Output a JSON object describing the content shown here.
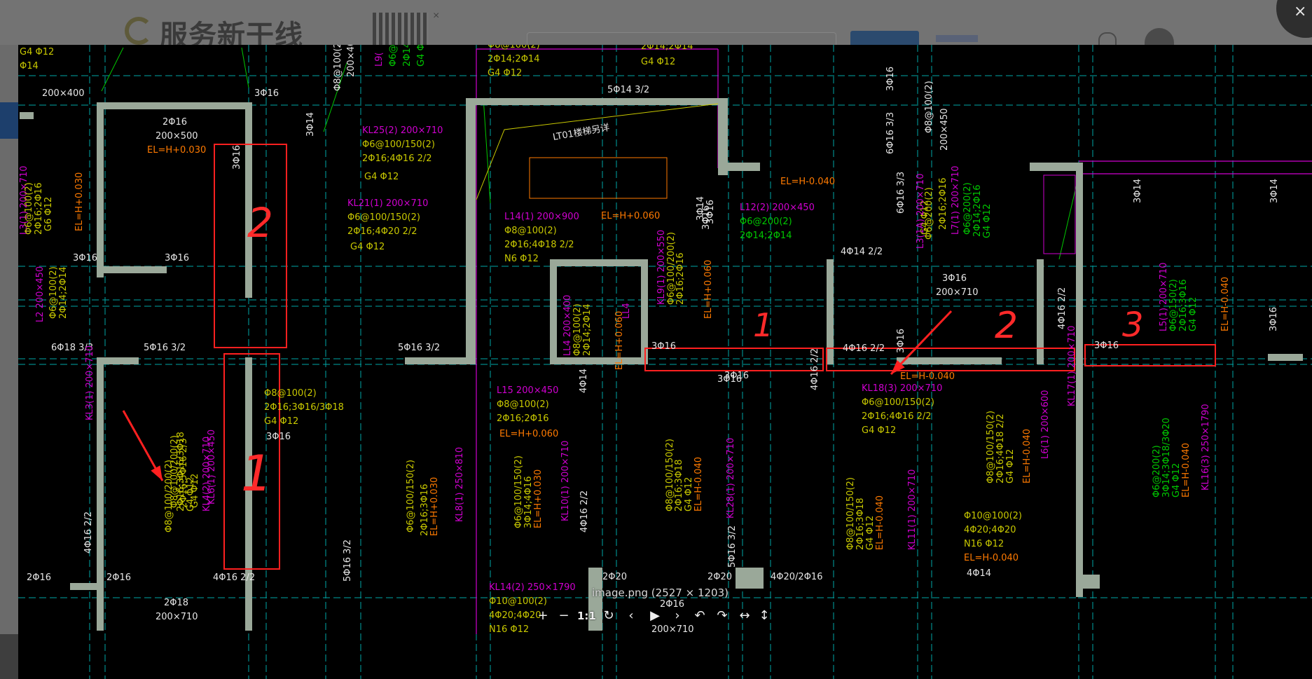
{
  "background_page": {
    "logo_text": "服务新干线"
  },
  "viewer": {
    "caption": "image.png (2527 × 1203)",
    "toolbar": {
      "zoom_in": "+",
      "zoom_out": "−",
      "actual_size": "1:1",
      "reset": "↻",
      "prev": "‹",
      "play": "▶",
      "next": "›",
      "rotate_left": "↶",
      "rotate_right": "↷",
      "flip_horizontal": "↔",
      "flip_vertical": "↕"
    },
    "close_label": "×"
  },
  "drawing": {
    "annotations": [
      {
        "id": "a2",
        "text": "2",
        "color": "#ff2a2a"
      },
      {
        "id": "a1",
        "text": "1",
        "color": "#ff2a2a"
      },
      {
        "id": "a1b",
        "text": "1",
        "color": "#ff2a2a"
      },
      {
        "id": "a2b",
        "text": "2",
        "color": "#ff2a2a"
      },
      {
        "id": "a3",
        "text": "3",
        "color": "#ff2a2a"
      }
    ],
    "colors": {
      "beam": "#c8c800",
      "green": "#00c800",
      "magenta": "#d000d0",
      "orange": "#ff7a00",
      "white": "#e6e6e6",
      "cyan": "#00a6a6",
      "wall": "#9aa899",
      "red": "#ff2020"
    },
    "labels": [
      {
        "t": "G4 Φ12",
        "c": "yellow"
      },
      {
        "t": "Φ14",
        "c": "yellow"
      },
      {
        "t": "200×400",
        "c": "white"
      },
      {
        "t": "3Φ16",
        "c": "white"
      },
      {
        "t": "Φ8@100(2)",
        "c": "white"
      },
      {
        "t": "200×400",
        "c": "white"
      },
      {
        "t": "L9(",
        "c": "magenta"
      },
      {
        "t": "Φ6@",
        "c": "green"
      },
      {
        "t": "2Φ14",
        "c": "green"
      },
      {
        "t": "G4 Φ",
        "c": "green"
      },
      {
        "t": "Φ8@100(2)",
        "c": "yellow"
      },
      {
        "t": "2Φ14;2Φ14",
        "c": "yellow"
      },
      {
        "t": "G4 Φ12",
        "c": "yellow"
      },
      {
        "t": "2Φ14;2Φ14",
        "c": "yellow"
      },
      {
        "t": "G4 Φ12",
        "c": "yellow"
      },
      {
        "t": "3Φ16",
        "c": "white"
      },
      {
        "t": "5Φ14 3/2",
        "c": "white"
      },
      {
        "t": "2Φ16",
        "c": "white"
      },
      {
        "t": "200×500",
        "c": "white"
      },
      {
        "t": "EL=H+0.030",
        "c": "orange"
      },
      {
        "t": "3Φ16",
        "c": "white"
      },
      {
        "t": "3Φ14",
        "c": "white"
      },
      {
        "t": "KL25(2) 200×710",
        "c": "magenta"
      },
      {
        "t": "Φ6@100/150(2)",
        "c": "yellow"
      },
      {
        "t": "2Φ16;4Φ16 2/2",
        "c": "yellow"
      },
      {
        "t": "G4 Φ12",
        "c": "yellow"
      },
      {
        "t": "LT01楼梯另详",
        "c": "white"
      },
      {
        "t": "Φ8@100(2)",
        "c": "white"
      },
      {
        "t": "200×450",
        "c": "white"
      },
      {
        "t": "6Φ16 3/3",
        "c": "white"
      },
      {
        "t": "EL=H-0.040",
        "c": "orange"
      },
      {
        "t": "L3(1) 200×710",
        "c": "magenta"
      },
      {
        "t": "Φ6@100(2)",
        "c": "yellow"
      },
      {
        "t": "2Φ16;2Φ16",
        "c": "yellow"
      },
      {
        "t": "G6 Φ12",
        "c": "yellow"
      },
      {
        "t": "EL=H+0.030",
        "c": "orange"
      },
      {
        "t": "KL21(1) 200×710",
        "c": "magenta"
      },
      {
        "t": "Φ6@100/150(2)",
        "c": "yellow"
      },
      {
        "t": "2Φ16;4Φ20 2/2",
        "c": "yellow"
      },
      {
        "t": "G4 Φ12",
        "c": "yellow"
      },
      {
        "t": "L14(1) 200×900",
        "c": "magenta"
      },
      {
        "t": "Φ8@100(2)",
        "c": "yellow"
      },
      {
        "t": "2Φ16;4Φ18 2/2",
        "c": "yellow"
      },
      {
        "t": "N6 Φ12",
        "c": "yellow"
      },
      {
        "t": "EL=H+0.060",
        "c": "orange"
      },
      {
        "t": "3Φ16",
        "c": "white"
      },
      {
        "t": "L12(2) 200×450",
        "c": "magenta"
      },
      {
        "t": "Φ6@200(2)",
        "c": "green"
      },
      {
        "t": "2Φ14;2Φ14",
        "c": "green"
      },
      {
        "t": "6Φ16 3/3",
        "c": "white"
      },
      {
        "t": "G4 Φ12",
        "c": "yellow"
      },
      {
        "t": "L3(1A) 200×710",
        "c": "magenta"
      },
      {
        "t": "Φ6@200(2)",
        "c": "yellow"
      },
      {
        "t": "2Φ16;2Φ16",
        "c": "yellow"
      },
      {
        "t": "L7(1) 200×710",
        "c": "magenta"
      },
      {
        "t": "Φ6@200(2)",
        "c": "green"
      },
      {
        "t": "2Φ14;2Φ16",
        "c": "green"
      },
      {
        "t": "G4 Φ12",
        "c": "green"
      },
      {
        "t": "3Φ14",
        "c": "white"
      },
      {
        "t": "3Φ14",
        "c": "white"
      },
      {
        "t": "3Φ14",
        "c": "white"
      },
      {
        "t": "3Φ16",
        "c": "white"
      },
      {
        "t": "3Φ16",
        "c": "white"
      },
      {
        "t": "4Φ14 2/2",
        "c": "white"
      },
      {
        "t": "3Φ16",
        "c": "white"
      },
      {
        "t": "200×710",
        "c": "white"
      },
      {
        "t": "L2 200×450",
        "c": "magenta"
      },
      {
        "t": "Φ6@100(2)",
        "c": "yellow"
      },
      {
        "t": "2Φ14;2Φ14",
        "c": "yellow"
      },
      {
        "t": "3Φ16",
        "c": "white"
      },
      {
        "t": "LL4 200×400",
        "c": "magenta"
      },
      {
        "t": "Φ8@100(2)",
        "c": "yellow"
      },
      {
        "t": "2Φ14;2Φ14",
        "c": "yellow"
      },
      {
        "t": "EL=H+0.060",
        "c": "orange"
      },
      {
        "t": "LL4",
        "c": "magenta"
      },
      {
        "t": "KL9(1) 200×550",
        "c": "magenta"
      },
      {
        "t": "Φ6@100/200(2)",
        "c": "yellow"
      },
      {
        "t": "2Φ16;2Φ16",
        "c": "yellow"
      },
      {
        "t": "EL=H+0.060",
        "c": "orange"
      },
      {
        "t": "4Φ16 2/2",
        "c": "white"
      },
      {
        "t": "L5(1) 200×710",
        "c": "magenta"
      },
      {
        "t": "Φ6@150(2)",
        "c": "green"
      },
      {
        "t": "2Φ16;3Φ16",
        "c": "green"
      },
      {
        "t": "G4 Φ12",
        "c": "green"
      },
      {
        "t": "EL=H-0.040",
        "c": "orange"
      },
      {
        "t": "3Φ16",
        "c": "white"
      },
      {
        "t": "6Φ18 3/3",
        "c": "white"
      },
      {
        "t": "5Φ16 3/2",
        "c": "white"
      },
      {
        "t": "5Φ16 3/2",
        "c": "white"
      },
      {
        "t": "3Φ16",
        "c": "white"
      },
      {
        "t": "4Φ16 2/2",
        "c": "white"
      },
      {
        "t": "3Φ16",
        "c": "white"
      },
      {
        "t": "EL=H-0.040",
        "c": "orange"
      },
      {
        "t": "KL18(3) 200×710",
        "c": "magenta"
      },
      {
        "t": "Φ6@100/150(2)",
        "c": "yellow"
      },
      {
        "t": "2Φ16;4Φ16 2/2",
        "c": "yellow"
      },
      {
        "t": "G4 Φ12",
        "c": "yellow"
      },
      {
        "t": "3Φ16",
        "c": "white"
      },
      {
        "t": "KL17(1) 200×710",
        "c": "magenta"
      },
      {
        "t": "Φ8@100(2)",
        "c": "yellow"
      },
      {
        "t": "2Φ16;3Φ16/3Φ18",
        "c": "yellow"
      },
      {
        "t": "G4 Φ12",
        "c": "yellow"
      },
      {
        "t": "3Φ16",
        "c": "white"
      },
      {
        "t": "L15 200×450",
        "c": "magenta"
      },
      {
        "t": "Φ8@100(2)",
        "c": "yellow"
      },
      {
        "t": "2Φ16;2Φ16",
        "c": "yellow"
      },
      {
        "t": "EL=H+0.060",
        "c": "orange"
      },
      {
        "t": "4Φ14",
        "c": "white"
      },
      {
        "t": "4Φ16 2/2",
        "c": "white"
      },
      {
        "t": "KL3(1) 200×710",
        "c": "magenta"
      },
      {
        "t": "Φ8@100/200(2)",
        "c": "yellow"
      },
      {
        "t": "2Φ16;3Φ16/3Φ18",
        "c": "yellow"
      },
      {
        "t": "G4 Φ12",
        "c": "yellow"
      },
      {
        "t": "KL4(2) 200×710",
        "c": "magenta"
      },
      {
        "t": "Φ8@100/200(2)",
        "c": "yellow"
      },
      {
        "t": "2Φ16;5Φ16 2/3",
        "c": "yellow"
      },
      {
        "t": "G4 Φ12",
        "c": "yellow"
      },
      {
        "t": "KL6(1) 200×450",
        "c": "magenta"
      },
      {
        "t": "Φ6@100/150(2)",
        "c": "yellow"
      },
      {
        "t": "2Φ16;3Φ16",
        "c": "yellow"
      },
      {
        "t": "EL=H+0.030",
        "c": "orange"
      },
      {
        "t": "KL8(1) 250×810",
        "c": "magenta"
      },
      {
        "t": "Φ6@100/150(2)",
        "c": "yellow"
      },
      {
        "t": "3Φ14;4Φ16",
        "c": "yellow"
      },
      {
        "t": "EL=H+0.030",
        "c": "orange"
      },
      {
        "t": "KL10(1) 200×710",
        "c": "magenta"
      },
      {
        "t": "Φ8@100/150(2)",
        "c": "yellow"
      },
      {
        "t": "2Φ16;3Φ18",
        "c": "yellow"
      },
      {
        "t": "G4 Φ12",
        "c": "yellow"
      },
      {
        "t": "EL=H-0.040",
        "c": "orange"
      },
      {
        "t": "KL28(1) 200×710",
        "c": "magenta"
      },
      {
        "t": "Φ8@100/150(2)",
        "c": "yellow"
      },
      {
        "t": "2Φ16;3Φ18",
        "c": "yellow"
      },
      {
        "t": "G4 Φ12",
        "c": "yellow"
      },
      {
        "t": "EL=H-0.040",
        "c": "orange"
      },
      {
        "t": "KL11(1) 200×710",
        "c": "magenta"
      },
      {
        "t": "Φ8@100/150(2)",
        "c": "yellow"
      },
      {
        "t": "2Φ16;4Φ18 2/2",
        "c": "yellow"
      },
      {
        "t": "G4 Φ12",
        "c": "yellow"
      },
      {
        "t": "EL=H-0.040",
        "c": "orange"
      },
      {
        "t": "L6(1) 200×600",
        "c": "magenta"
      },
      {
        "t": "Φ6@200(2)",
        "c": "green"
      },
      {
        "t": "3Φ14;3Φ18/3Φ20",
        "c": "green"
      },
      {
        "t": "G4 Φ12",
        "c": "green"
      },
      {
        "t": "EL=H-0.040",
        "c": "orange"
      },
      {
        "t": "KL16(3) 250×1790",
        "c": "magenta"
      },
      {
        "t": "Φ10@100(2)",
        "c": "yellow"
      },
      {
        "t": "4Φ20;4Φ20",
        "c": "yellow"
      },
      {
        "t": "N16 Φ12",
        "c": "yellow"
      },
      {
        "t": "EL=H-0.040",
        "c": "orange"
      },
      {
        "t": "4Φ14",
        "c": "white"
      },
      {
        "t": "4Φ16 2/2",
        "c": "white"
      },
      {
        "t": "4Φ16 2/2",
        "c": "white"
      },
      {
        "t": "5Φ16 3/2",
        "c": "white"
      },
      {
        "t": "5Φ16 3/2",
        "c": "white"
      },
      {
        "t": "2Φ16",
        "c": "white"
      },
      {
        "t": "2Φ16",
        "c": "white"
      },
      {
        "t": "4Φ16 2/2",
        "c": "white"
      },
      {
        "t": "2Φ20",
        "c": "white"
      },
      {
        "t": "2Φ20",
        "c": "white"
      },
      {
        "t": "4Φ20/2Φ16",
        "c": "white"
      },
      {
        "t": "2Φ18",
        "c": "white"
      },
      {
        "t": "200×710",
        "c": "white"
      },
      {
        "t": "KL14(2) 250×1790",
        "c": "magenta"
      },
      {
        "t": "Φ10@100(2)",
        "c": "yellow"
      },
      {
        "t": "4Φ20;4Φ20",
        "c": "yellow"
      },
      {
        "t": "N16 Φ12",
        "c": "yellow"
      },
      {
        "t": "2Φ16",
        "c": "white"
      },
      {
        "t": "200×710",
        "c": "white"
      },
      {
        "t": "3Φ16",
        "c": "white"
      },
      {
        "t": "3Φ16",
        "c": "white"
      }
    ]
  }
}
